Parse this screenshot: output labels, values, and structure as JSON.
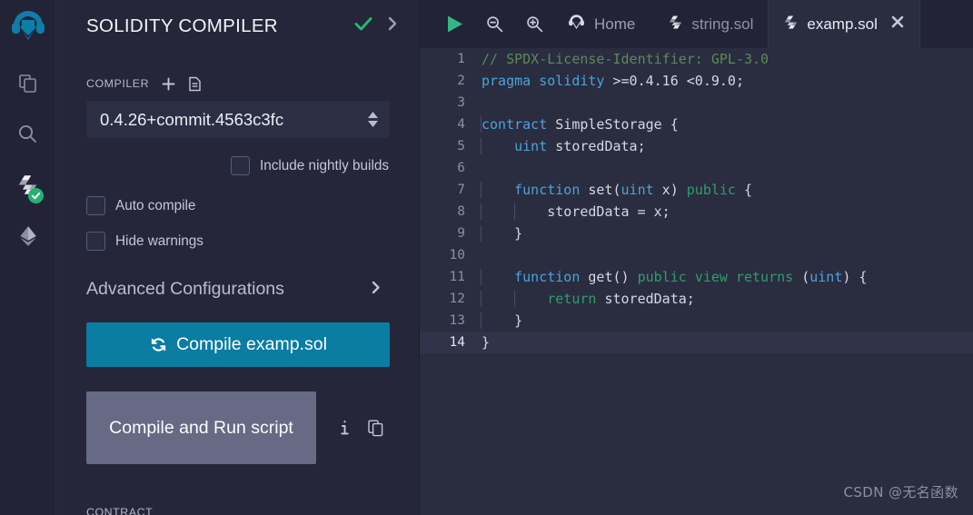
{
  "iconbar": {
    "logo_name": "remix-logo",
    "items": [
      {
        "name": "file-explorer-icon",
        "title": "File explorers"
      },
      {
        "name": "search-icon",
        "title": "Search in files"
      },
      {
        "name": "solidity-compiler-icon",
        "title": "Solidity compiler",
        "badge": "check"
      },
      {
        "name": "deploy-run-icon",
        "title": "Deploy & run transactions"
      }
    ]
  },
  "panel": {
    "title": "SOLIDITY COMPILER",
    "status_check": "✔",
    "expand_chevron": "›",
    "compiler_label": "COMPILER",
    "add_icon_name": "plus-icon",
    "file_icon_name": "document-icon",
    "compiler_version": "0.4.26+commit.4563c3fc",
    "nightly_label": "Include nightly builds",
    "auto_compile_label": "Auto compile",
    "hide_warnings_label": "Hide warnings",
    "advanced_label": "Advanced Configurations",
    "advanced_chevron": "›",
    "compile_button_label": "Compile examp.sol",
    "compile_icon_name": "refresh-icon",
    "run_button_label": "Compile and Run script",
    "info_icon_name": "info-icon",
    "copy_icon_name": "copy-icon",
    "contract_label": "CONTRACT"
  },
  "toolbar": {
    "run_icon_name": "play-icon",
    "zoom_out_icon_name": "zoom-out-icon",
    "zoom_in_icon_name": "zoom-in-icon"
  },
  "tabs": [
    {
      "label": "Home",
      "icon": "remix-home-icon",
      "active": false,
      "closable": false
    },
    {
      "label": "string.sol",
      "icon": "solidity-icon",
      "active": false,
      "closable": false
    },
    {
      "label": "examp.sol",
      "icon": "solidity-icon",
      "active": true,
      "closable": true,
      "close_glyph": "✖"
    }
  ],
  "editor": {
    "active_line": 14,
    "lines": [
      {
        "n": 1,
        "tokens": [
          {
            "t": "// SPDX-License-Identifier: GPL-3.0",
            "c": "tok-cmt"
          }
        ]
      },
      {
        "n": 2,
        "tokens": [
          {
            "t": "pragma",
            "c": "tok-kw"
          },
          {
            "t": " ",
            "c": "tok-txt"
          },
          {
            "t": "solidity",
            "c": "tok-kw"
          },
          {
            "t": " >=0.4.16 <0.9.0;",
            "c": "tok-txt"
          }
        ]
      },
      {
        "n": 3,
        "tokens": []
      },
      {
        "n": 4,
        "tokens": [
          {
            "t": "contract",
            "c": "tok-kw"
          },
          {
            "t": " SimpleStorage {",
            "c": "tok-txt"
          }
        ]
      },
      {
        "n": 5,
        "tokens": [
          {
            "t": "    ",
            "c": "tok-txt"
          },
          {
            "t": "uint",
            "c": "tok-type"
          },
          {
            "t": " storedData;",
            "c": "tok-txt"
          }
        ]
      },
      {
        "n": 6,
        "tokens": []
      },
      {
        "n": 7,
        "tokens": [
          {
            "t": "    ",
            "c": "tok-txt"
          },
          {
            "t": "function",
            "c": "tok-kw"
          },
          {
            "t": " set(",
            "c": "tok-txt"
          },
          {
            "t": "uint",
            "c": "tok-type"
          },
          {
            "t": " x) ",
            "c": "tok-txt"
          },
          {
            "t": "public",
            "c": "tok-kw2"
          },
          {
            "t": " {",
            "c": "tok-txt"
          }
        ]
      },
      {
        "n": 8,
        "tokens": [
          {
            "t": "        storedData = x;",
            "c": "tok-txt"
          }
        ]
      },
      {
        "n": 9,
        "tokens": [
          {
            "t": "    }",
            "c": "tok-txt"
          }
        ]
      },
      {
        "n": 10,
        "tokens": []
      },
      {
        "n": 11,
        "tokens": [
          {
            "t": "    ",
            "c": "tok-txt"
          },
          {
            "t": "function",
            "c": "tok-kw"
          },
          {
            "t": " get() ",
            "c": "tok-txt"
          },
          {
            "t": "public",
            "c": "tok-kw2"
          },
          {
            "t": " ",
            "c": "tok-txt"
          },
          {
            "t": "view",
            "c": "tok-kw2"
          },
          {
            "t": " ",
            "c": "tok-txt"
          },
          {
            "t": "returns",
            "c": "tok-kw2"
          },
          {
            "t": " (",
            "c": "tok-txt"
          },
          {
            "t": "uint",
            "c": "tok-type"
          },
          {
            "t": ") {",
            "c": "tok-txt"
          }
        ]
      },
      {
        "n": 12,
        "tokens": [
          {
            "t": "        ",
            "c": "tok-txt"
          },
          {
            "t": "return",
            "c": "tok-kw2"
          },
          {
            "t": " storedData;",
            "c": "tok-txt"
          }
        ]
      },
      {
        "n": 13,
        "tokens": [
          {
            "t": "    }",
            "c": "tok-txt"
          }
        ]
      },
      {
        "n": 14,
        "tokens": [
          {
            "t": "}",
            "c": "tok-txt"
          }
        ]
      }
    ]
  },
  "watermark": "CSDN @无名函数",
  "colors": {
    "accent_blue": "#0b7ca2",
    "panel_bg": "#252639",
    "editor_bg": "#2a2c40",
    "chrome_bg": "#222336",
    "success_green": "#26b173",
    "muted_button": "#666a84"
  }
}
